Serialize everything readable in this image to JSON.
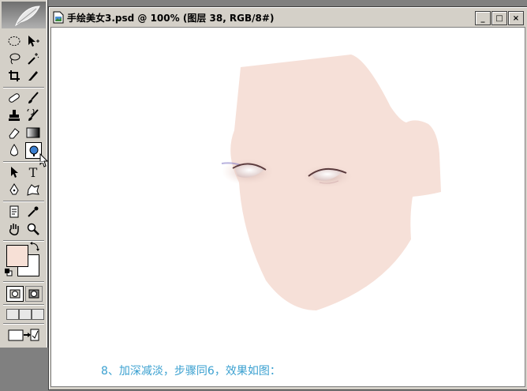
{
  "document": {
    "title": "手绘美女3.psd @ 100% (图层 38, RGB/8#)",
    "caption": "8、加深减淡，步骤同6，效果如图：",
    "window_buttons": {
      "minimize": "_",
      "maximize": "□",
      "close": "×"
    }
  },
  "toolbox": {
    "tools": [
      "elliptical-marquee-icon",
      "move-icon",
      "lasso-icon",
      "magic-wand-icon",
      "crop-icon",
      "slice-icon",
      "healing-brush-icon",
      "brush-icon",
      "clone-stamp-icon",
      "history-brush-icon",
      "eraser-icon",
      "gradient-icon",
      "blur-icon",
      "dodge-icon",
      "path-selection-icon",
      "type-icon",
      "pen-icon",
      "custom-shape-icon",
      "notes-icon",
      "eyedropper-icon",
      "hand-icon",
      "zoom-icon"
    ],
    "active_tool": "dodge-icon",
    "foreground_color": "#f7e0d6",
    "background_color": "#ffffff",
    "type_label": "T"
  },
  "colors": {
    "skin": "#f6e0d8",
    "caption": "#3aa0d0"
  }
}
